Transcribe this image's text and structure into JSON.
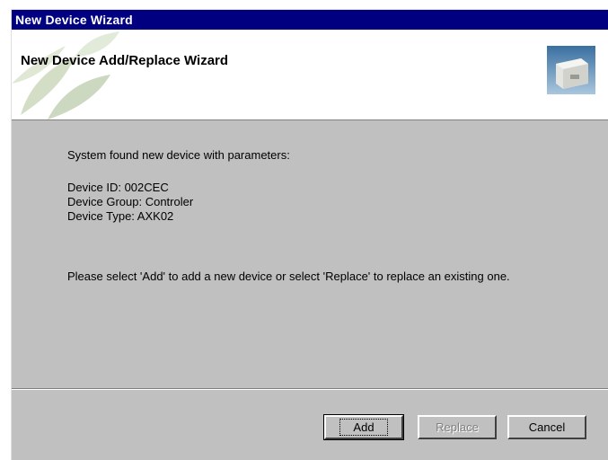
{
  "window": {
    "title": "New Device Wizard"
  },
  "header": {
    "title": "New Device Add/Replace Wizard",
    "icon": "device-box-icon"
  },
  "body": {
    "found_text": "System found new device with parameters:",
    "params": [
      "Device ID: 002CEC",
      "Device Group: Controler",
      "Device Type: AXK02"
    ],
    "instruction": "Please select 'Add' to add a new device or select 'Replace' to replace an existing one."
  },
  "buttons": {
    "add": "Add",
    "replace": "Replace",
    "cancel": "Cancel"
  },
  "colors": {
    "titlebar": "#000080",
    "face": "#c0c0c0"
  }
}
